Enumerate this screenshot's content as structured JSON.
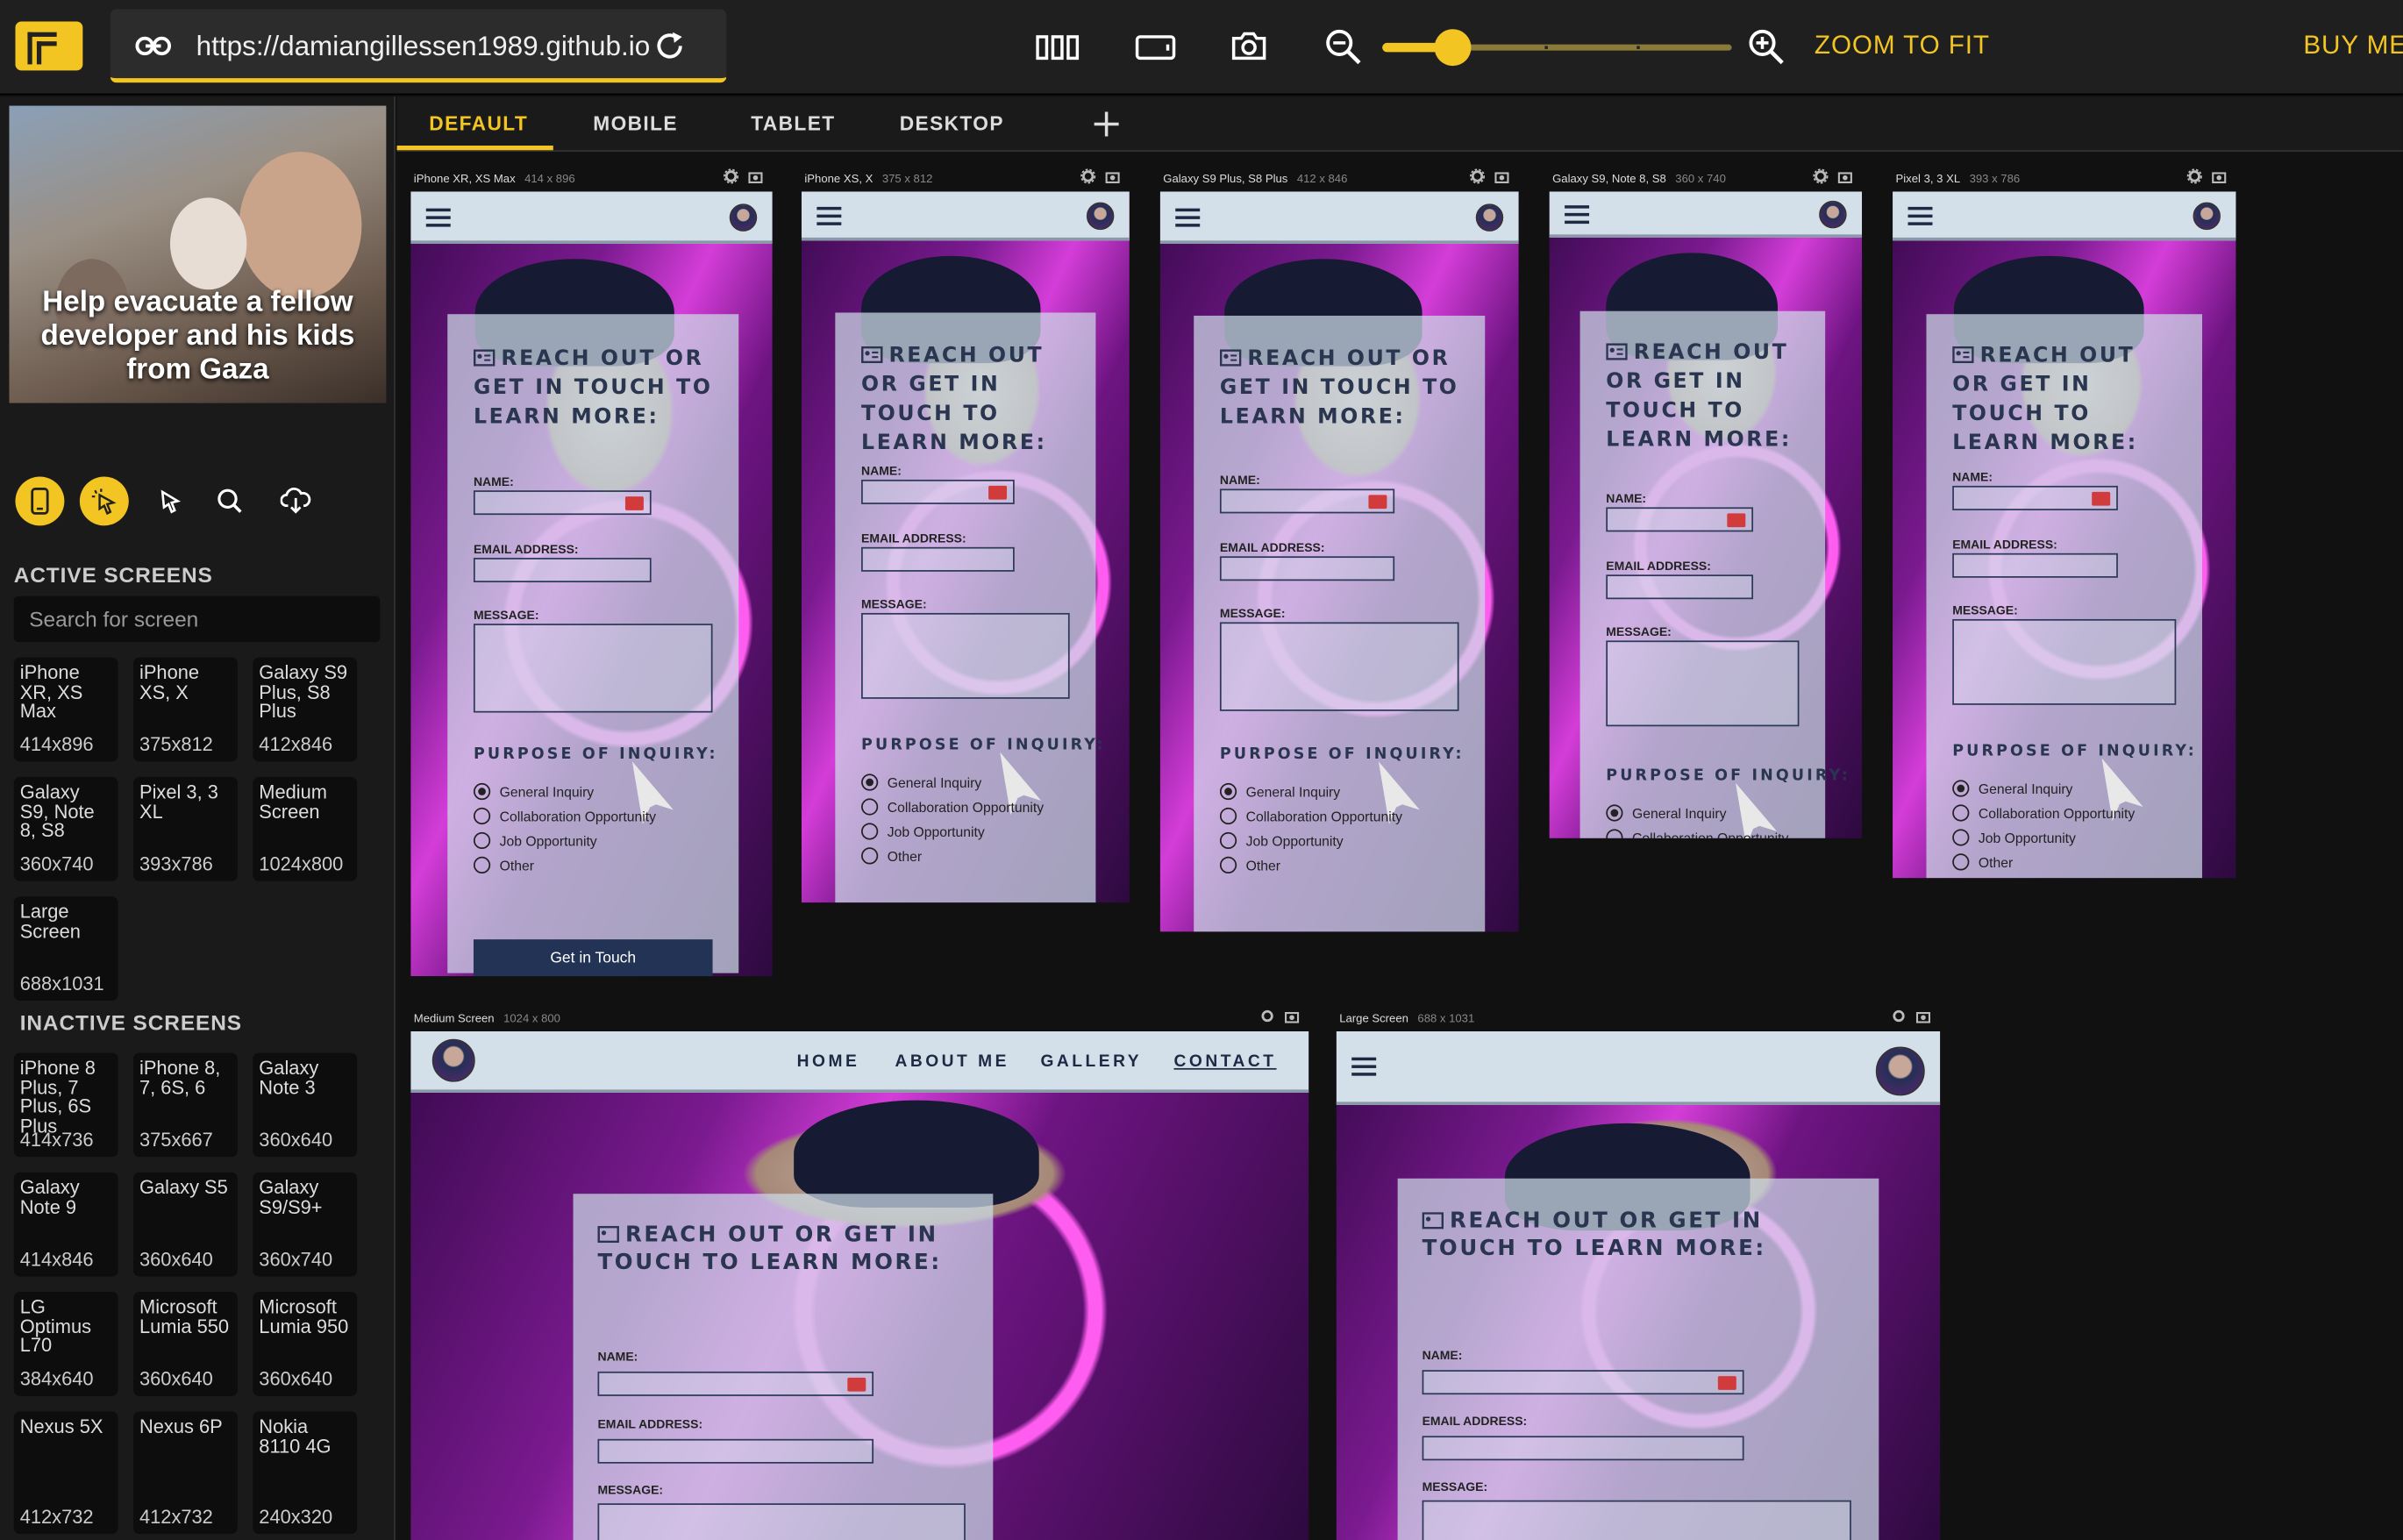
{
  "toolbar": {
    "url": "https://damiangillessen1989.github.io",
    "zoom_to_fit": "ZOOM TO FIT",
    "buy_me": "BUY ME A COFFEE",
    "zoom_level": 0.2
  },
  "banner": {
    "text": "Help evacuate a fellow developer and his kids from Gaza"
  },
  "sidebar": {
    "active_title": "ACTIVE SCREENS",
    "inactive_title": "INACTIVE SCREENS",
    "search_placeholder": "Search for screen",
    "active": [
      {
        "name": "iPhone XR, XS Max",
        "size": "414x896"
      },
      {
        "name": "iPhone XS, X",
        "size": "375x812"
      },
      {
        "name": "Galaxy S9 Plus, S8 Plus",
        "size": "412x846"
      },
      {
        "name": "Galaxy S9, Note 8, S8",
        "size": "360x740"
      },
      {
        "name": "Pixel 3, 3 XL",
        "size": "393x786"
      },
      {
        "name": "Medium Screen",
        "size": "1024x800"
      },
      {
        "name": "Large Screen",
        "size": "688x1031"
      }
    ],
    "inactive": [
      {
        "name": "iPhone 8 Plus, 7 Plus, 6S Plus",
        "size": "414x736"
      },
      {
        "name": "iPhone 8, 7, 6S, 6",
        "size": "375x667"
      },
      {
        "name": "Galaxy Note 3",
        "size": "360x640"
      },
      {
        "name": "Galaxy Note 9",
        "size": "414x846"
      },
      {
        "name": "Galaxy S5",
        "size": "360x640"
      },
      {
        "name": "Galaxy S9/S9+",
        "size": "360x740"
      },
      {
        "name": "LG Optimus L70",
        "size": "384x640"
      },
      {
        "name": "Microsoft Lumia 550",
        "size": "360x640"
      },
      {
        "name": "Microsoft Lumia 950",
        "size": "360x640"
      },
      {
        "name": "Nexus 5X",
        "size": "412x732"
      },
      {
        "name": "Nexus 6P",
        "size": "412x732"
      },
      {
        "name": "Nokia 8110 4G",
        "size": "240x320"
      }
    ]
  },
  "tabs": [
    "DEFAULT",
    "MOBILE",
    "TABLET",
    "DESKTOP"
  ],
  "devices": [
    {
      "label": "iPhone XR, XS Max",
      "size": "414 x 896"
    },
    {
      "label": "iPhone XS, X",
      "size": "375 x 812"
    },
    {
      "label": "Galaxy S9 Plus, S8 Plus",
      "size": "412 x 846"
    },
    {
      "label": "Galaxy S9, Note 8, S8",
      "size": "360 x 740"
    },
    {
      "label": "Pixel 3, 3 XL",
      "size": "393 x 786"
    },
    {
      "label": "Medium Screen",
      "size": "1024 x 800"
    },
    {
      "label": "Large Screen",
      "size": "688 x 1031"
    }
  ],
  "form": {
    "title": "REACH OUT OR GET IN TOUCH TO LEARN MORE:",
    "name_label": "NAME:",
    "email_label": "EMAIL ADDRESS:",
    "message_label": "MESSAGE:",
    "purpose_label": "PURPOSE OF INQUIRY:",
    "options": [
      "General Inquiry",
      "Collaboration Opportunity",
      "Job Opportunity",
      "Other"
    ],
    "submit": "Get in Touch"
  },
  "nav": [
    "HOME",
    "ABOUT ME",
    "GALLERY",
    "CONTACT"
  ],
  "colors": {
    "accent": "#f2c522",
    "header": "#d3e0ea",
    "text_dark": "#2a3550",
    "neon": "#d43dd8"
  }
}
